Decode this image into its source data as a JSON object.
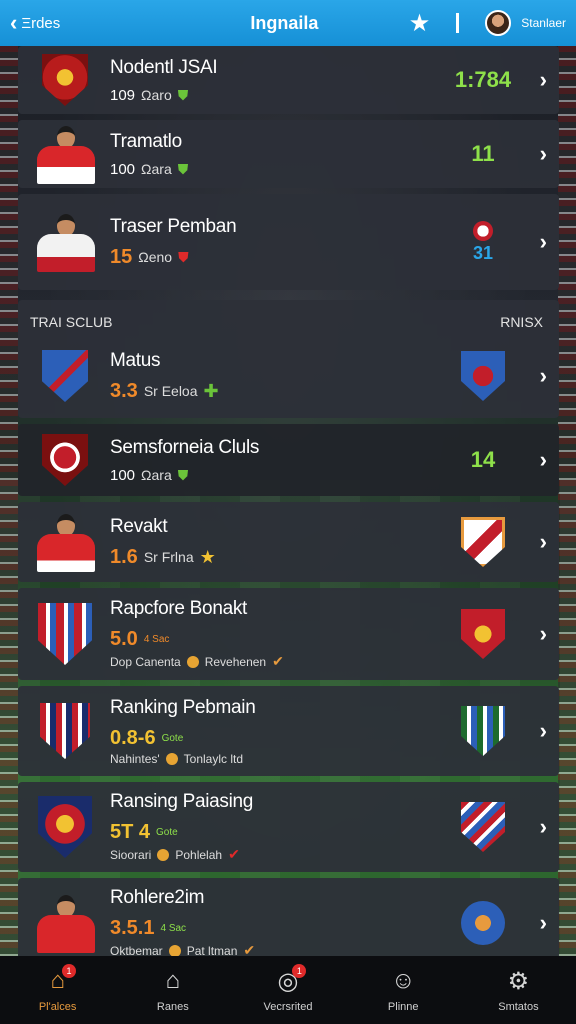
{
  "header": {
    "back_label": "Ξrdes",
    "title": "Ingnaila",
    "user_name": "Stanlaer"
  },
  "section": {
    "left": "TRAI SCLUB",
    "right": "RNISX"
  },
  "rows": [
    {
      "name": "Nodentl JSAI",
      "value": "109",
      "unit": "Ωaro",
      "icon": "shield-icon",
      "right": "1:784",
      "right_color": "#8ee04a"
    },
    {
      "name": "Tramatlo",
      "value": "100",
      "unit": "Ωara",
      "icon": "shield-icon",
      "right": "11",
      "right_color": "#8ee04a"
    },
    {
      "name": "Traser Pemban",
      "value": "15",
      "unit": "Ωeno",
      "icon": "shield-red-icon",
      "right": "31",
      "right_color": "#2aa6e8"
    },
    {
      "name": "Matus",
      "value": "3.3",
      "unit": "Sr Eeloa",
      "icon": "plus-icon"
    },
    {
      "name": "Semsforneia Cluls",
      "value": "100",
      "unit": "Ωara",
      "icon": "shield-icon",
      "right": "14",
      "right_color": "#8ee04a"
    },
    {
      "name": "Revakt",
      "value": "1.6",
      "unit": "Sr Frlna",
      "icon": "star-icon"
    },
    {
      "name": "Rapcfore Bonakt",
      "value": "5.0",
      "small": "4 Sac",
      "sub1": "Dop Canenta",
      "sub2": "Revehenen"
    },
    {
      "name": "Ranking Pebmain",
      "value": "0.8-6",
      "small": "Gote",
      "sub1": "Nahintes'",
      "sub2": "Tonlaylc ltd"
    },
    {
      "name": "Ransing Paiasing",
      "value": "5T 4",
      "small": "Gote",
      "sub1": "Sioorari",
      "sub2": "Pohlelah"
    },
    {
      "name": "Rohlere2im",
      "value": "3.5.1",
      "small": "4 Sac",
      "sub1": "Oktbemar",
      "sub2": "Pat ltman"
    }
  ],
  "nav": [
    {
      "label": "Pl'alces",
      "icon": "home-icon",
      "badge": "1",
      "active": true
    },
    {
      "label": "Ranes",
      "icon": "home-icon",
      "active": false
    },
    {
      "label": "Vecrsrited",
      "icon": "ball-icon",
      "badge": "1",
      "active": false
    },
    {
      "label": "Plinne",
      "icon": "person-icon",
      "active": false
    },
    {
      "label": "Smtatos",
      "icon": "settings-icon",
      "active": false
    }
  ],
  "colors": {
    "accent": "#1690d6",
    "green": "#8ee04a",
    "orange": "#f08a2a",
    "nav_active": "#e79a3e"
  }
}
